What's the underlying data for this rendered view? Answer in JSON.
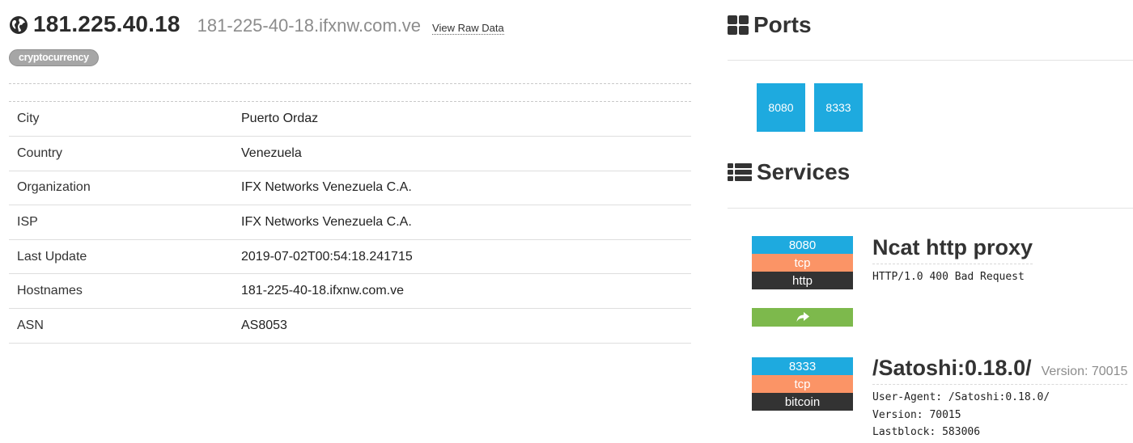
{
  "host": {
    "ip": "181.225.40.18",
    "hostname": "181-225-40-18.ifxnw.com.ve",
    "raw_data_link": "View Raw Data",
    "tag": "cryptocurrency",
    "globe_icon": "globe-icon"
  },
  "info": {
    "rows": [
      {
        "label": "City",
        "value": "Puerto Ordaz"
      },
      {
        "label": "Country",
        "value": "Venezuela"
      },
      {
        "label": "Organization",
        "value": "IFX Networks Venezuela C.A."
      },
      {
        "label": "ISP",
        "value": "IFX Networks Venezuela C.A."
      },
      {
        "label": "Last Update",
        "value": "2019-07-02T00:54:18.241715"
      },
      {
        "label": "Hostnames",
        "value": "181-225-40-18.ifxnw.com.ve"
      },
      {
        "label": "ASN",
        "value": "AS8053"
      }
    ]
  },
  "ports": {
    "title": "Ports",
    "icon": "grid-icon",
    "list": [
      "8080",
      "8333"
    ]
  },
  "services": {
    "title": "Services",
    "icon": "list-icon",
    "items": [
      {
        "port": "8080",
        "protocol": "tcp",
        "module": "http",
        "name": "Ncat http proxy",
        "version": "",
        "banner": "HTTP/1.0 400 Bad Request",
        "action_icon": "share-arrow-icon"
      },
      {
        "port": "8333",
        "protocol": "tcp",
        "module": "bitcoin",
        "name": "/Satoshi:0.18.0/",
        "version": "Version: 70015",
        "banner": "User-Agent: /Satoshi:0.18.0/\nVersion: 70015\nLastblock: 583006"
      }
    ]
  },
  "colors": {
    "port_blue": "#1eaadf",
    "protocol_orange": "#fb9466",
    "module_dark": "#333333",
    "action_green": "#7db94c",
    "tag_gray": "#a6a6a6"
  }
}
